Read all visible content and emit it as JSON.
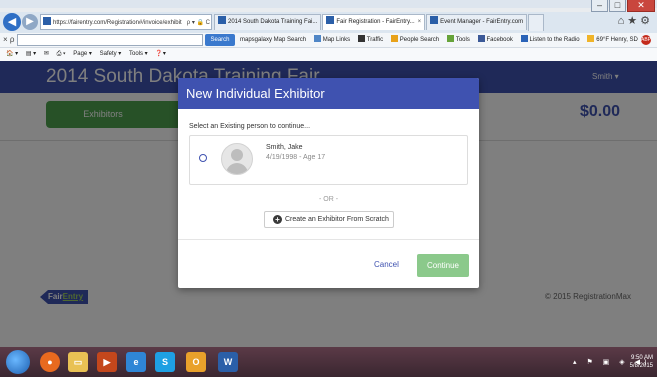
{
  "browser": {
    "address": "https://fairentry.com/Registration#/invoice/exhibit",
    "address_controls": "ρ ▾ 🔒 C",
    "tabs": [
      {
        "label": "2014 South Dakota Training Fai...",
        "active": false
      },
      {
        "label": "Fair Registration - FairEntry...",
        "active": true
      },
      {
        "label": "Event Manager - FairEntry.com",
        "active": false
      }
    ],
    "search_button": "Search",
    "links": [
      "mapsgalaxy Map Search",
      "Map Links",
      "Traffic",
      "People Search",
      "Tools",
      "Facebook",
      "Listen to the Radio",
      "69°F Henry, SD"
    ],
    "command_bar": [
      "Page ▾",
      "Safety ▾",
      "Tools ▾"
    ]
  },
  "site": {
    "title": "2014 South Dakota Training Fair",
    "user": "Smith ▾",
    "tab_exhibitors": "Exhibitors",
    "total": "$0.00",
    "footer_logo_a": "Fair",
    "footer_logo_b": "Entry",
    "copyright": "© 2015 RegistrationMax"
  },
  "modal": {
    "title": "New Individual Exhibitor",
    "subtitle": "Select an Existing person to continue...",
    "person": {
      "name": "Smith, Jake",
      "info": "4/19/1998 - Age 17"
    },
    "or_text": "- OR -",
    "create_button": "Create an Exhibitor From Scratch",
    "cancel": "Cancel",
    "continue": "Continue"
  },
  "taskbar": {
    "time": "9:50 AM",
    "date": "5/8/2015"
  },
  "colors": {
    "primary": "#3f52b0",
    "green": "#4fa34f",
    "continue_disabled": "#8bc98b"
  }
}
